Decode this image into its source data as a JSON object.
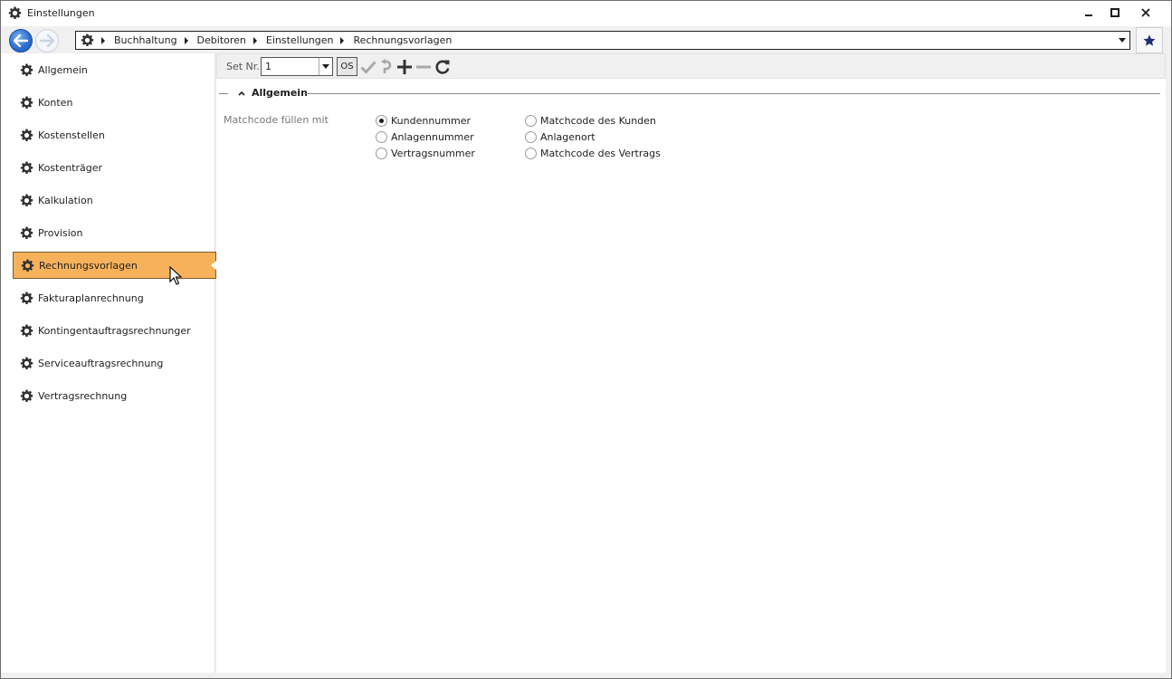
{
  "window": {
    "title": "Einstellungen"
  },
  "breadcrumb": {
    "items": [
      "Buchhaltung",
      "Debitoren",
      "Einstellungen",
      "Rechnungsvorlagen"
    ]
  },
  "sidebar": {
    "items": [
      {
        "label": "Allgemein"
      },
      {
        "label": "Konten"
      },
      {
        "label": "Kostenstellen"
      },
      {
        "label": "Kostenträger"
      },
      {
        "label": "Kalkulation"
      },
      {
        "label": "Provision"
      },
      {
        "label": "Rechnungsvorlagen",
        "active": true
      },
      {
        "label": "Fakturaplanrechnung"
      },
      {
        "label": "Kontingentauftragsrechnunger"
      },
      {
        "label": "Serviceauftragsrechnung"
      },
      {
        "label": "Vertragsrechnung"
      }
    ],
    "active_color": "#f8b15b"
  },
  "toolbar": {
    "set_label": "Set Nr.",
    "set_value": "1",
    "os_label": "OS"
  },
  "section": {
    "title": "Allgemein",
    "field_label": "Matchcode füllen mit",
    "options_left": [
      "Kundennummer",
      "Anlagennummer",
      "Vertragsnummer"
    ],
    "options_right": [
      "Matchcode des Kunden",
      "Anlagenort",
      "Matchcode des Vertrags"
    ],
    "selected": "Kundennummer"
  }
}
